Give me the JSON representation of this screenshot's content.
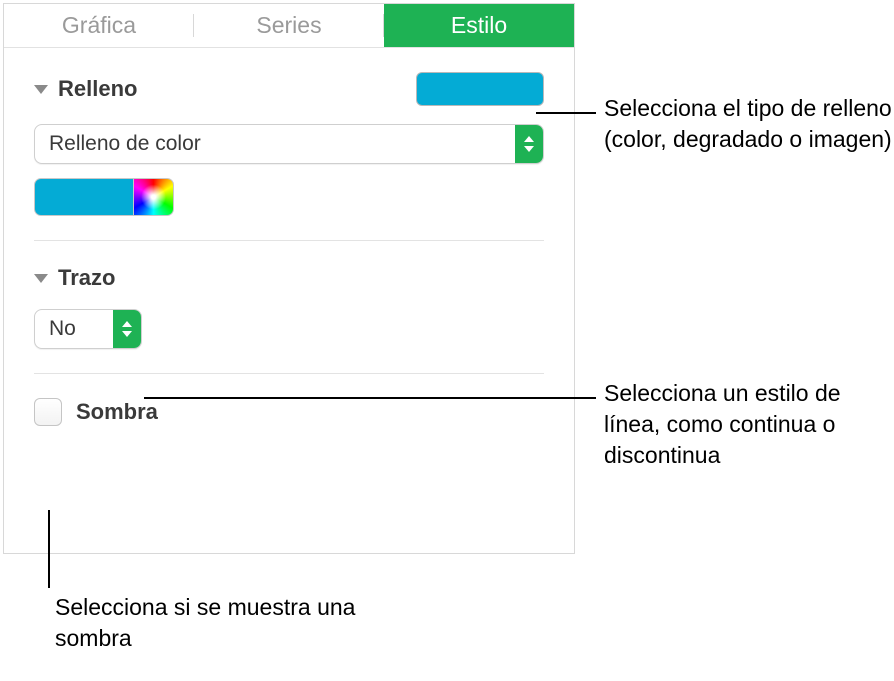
{
  "tabs": {
    "grafica": "Gráfica",
    "series": "Series",
    "estilo": "Estilo"
  },
  "fill": {
    "title": "Relleno",
    "type_label": "Relleno de color",
    "color": "#04abd5"
  },
  "stroke": {
    "title": "Trazo",
    "value": "No"
  },
  "shadow": {
    "label": "Sombra"
  },
  "callouts": {
    "fill": "Selecciona el tipo de relleno (color, degradado o imagen)",
    "stroke": "Selecciona un estilo de línea, como continua o discontinua",
    "shadow": "Selecciona si se muestra una sombra"
  }
}
